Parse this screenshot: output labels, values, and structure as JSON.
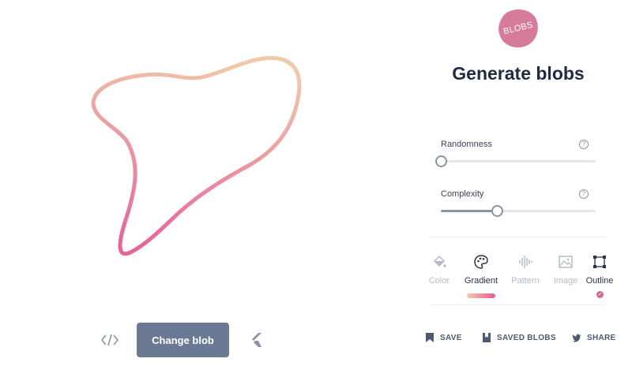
{
  "app": {
    "logo_text": "BLOBS",
    "title": "Generate blobs",
    "logo_color": "#d77b9a"
  },
  "blob": {
    "style": "outline",
    "gradient_colors": [
      "#f0c9a8",
      "#e8629a"
    ]
  },
  "controls": {
    "randomness": {
      "label": "Randomness",
      "value_fraction": 0.0,
      "help_icon": "question-circle-icon"
    },
    "complexity": {
      "label": "Complexity",
      "value_fraction": 0.36,
      "help_icon": "question-circle-icon"
    }
  },
  "tabs": [
    {
      "label": "Color",
      "icon": "paint-bucket-icon",
      "active": false
    },
    {
      "label": "Gradient",
      "icon": "palette-icon",
      "active": true
    },
    {
      "label": "Pattern",
      "icon": "sound-wave-icon",
      "active": false
    },
    {
      "label": "Image",
      "icon": "image-icon",
      "active": false
    },
    {
      "label": "Outline",
      "icon": "bounding-box-icon",
      "active": true,
      "checked": true
    }
  ],
  "bottom_bar": {
    "change_blob_label": "Change blob",
    "code_icon": "code-icon",
    "flutter_icon": "flutter-icon"
  },
  "actions": [
    {
      "label": "SAVE",
      "icon": "bookmark-icon"
    },
    {
      "label": "SAVED BLOBS",
      "icon": "bookmark-collection-icon"
    },
    {
      "label": "SHARE",
      "icon": "twitter-icon"
    }
  ],
  "colors": {
    "accent": "#6b7a94",
    "title": "#1f2a44",
    "muted": "#b5bbc6",
    "check": "#d6688f"
  }
}
